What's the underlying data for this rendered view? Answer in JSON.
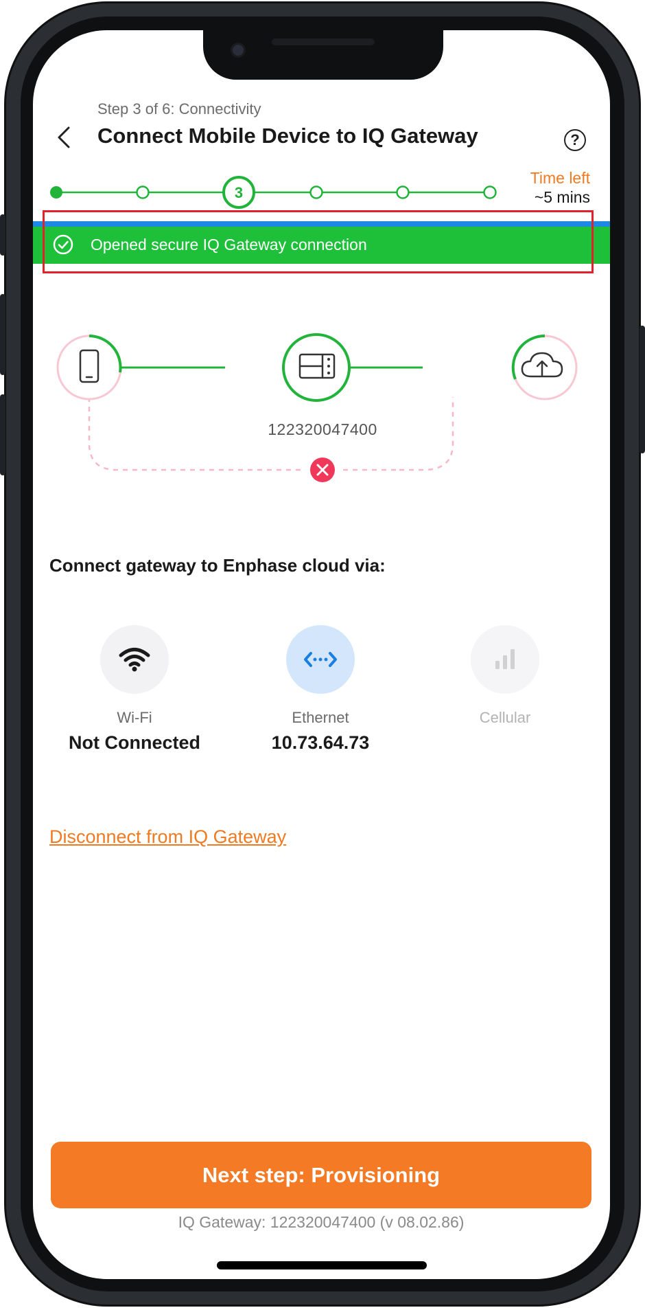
{
  "header": {
    "step_label": "Step 3 of 6: Connectivity",
    "title": "Connect Mobile Device to IQ Gateway"
  },
  "progress": {
    "total_steps": 6,
    "current_step": 3,
    "current_step_label": "3",
    "time_left_label": "Time left",
    "time_left_value": "~5 mins"
  },
  "banner": {
    "message": "Opened secure IQ Gateway connection",
    "color": "#1ec03a"
  },
  "topology": {
    "gateway_serial": "122320047400",
    "nodes": [
      "phone-icon",
      "gateway-icon",
      "cloud-upload-icon"
    ],
    "phone_to_cloud_status": "error"
  },
  "connect": {
    "label": "Connect gateway to Enphase cloud via:",
    "options": [
      {
        "name": "Wi-Fi",
        "value": "Not Connected",
        "icon": "wifi-icon",
        "state": "inactive"
      },
      {
        "name": "Ethernet",
        "value": "10.73.64.73",
        "icon": "ethernet-icon",
        "state": "active"
      },
      {
        "name": "Cellular",
        "value": "",
        "icon": "cellular-icon",
        "state": "disabled"
      }
    ]
  },
  "actions": {
    "disconnect_label": "Disconnect from IQ Gateway",
    "next_label": "Next step: Provisioning"
  },
  "footer": {
    "gateway_info": "IQ Gateway: 122320047400 (v 08.02.86)"
  },
  "colors": {
    "accent_orange": "#f47a26",
    "success_green": "#1ec03a",
    "progress_green": "#22b33a",
    "error_red": "#f0385a",
    "ethernet_blue": "#1a7fe0"
  }
}
